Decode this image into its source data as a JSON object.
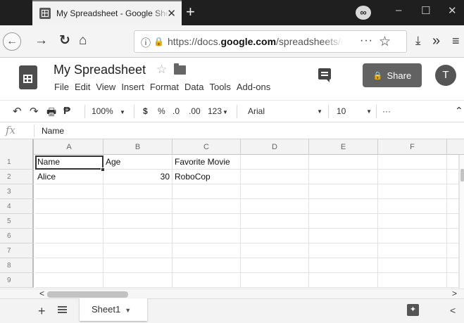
{
  "browser": {
    "tab_title": "My Spreadsheet - Google Sheets",
    "tab_close": "✕",
    "new_tab": "+",
    "window_buttons": [
      "–",
      "☐",
      "✕"
    ],
    "url_prefix": "https://docs.",
    "url_domain": "google.com",
    "url_path": "/spreadsheets/d/"
  },
  "doc": {
    "title": "My Spreadsheet",
    "menu": [
      "File",
      "Edit",
      "View",
      "Insert",
      "Format",
      "Data",
      "Tools",
      "Add-ons"
    ],
    "share_label": "Share",
    "avatar_letter": "T"
  },
  "toolbar": {
    "zoom": "100%",
    "currency": "$",
    "percent": "%",
    "decrease_decimals": ".0",
    "increase_decimals": ".00",
    "more_formats": "123",
    "font": "Arial",
    "font_size": "10",
    "more": "···"
  },
  "formula_bar": {
    "fx": "fx",
    "value": "Name"
  },
  "grid": {
    "columns": [
      "A",
      "B",
      "C",
      "D",
      "E",
      "F"
    ],
    "rows": [
      "1",
      "2",
      "3",
      "4",
      "5",
      "6",
      "7",
      "8",
      "9"
    ],
    "cells": {
      "A1": "Name",
      "B1": "Age",
      "C1": "Favorite Movie",
      "A2": "Alice",
      "B2": "30",
      "C2": "RoboCop"
    },
    "selected_cell": "A1"
  },
  "sheets": {
    "tabs": [
      "Sheet1"
    ],
    "active": "Sheet1"
  },
  "icons": {
    "back": "arrow-left-icon",
    "forward": "arrow-right-icon",
    "reload": "reload-icon",
    "home": "home-icon",
    "downloads": "download-icon",
    "overflow": "chevron-double-right-icon",
    "hamburger": "menu-icon"
  }
}
